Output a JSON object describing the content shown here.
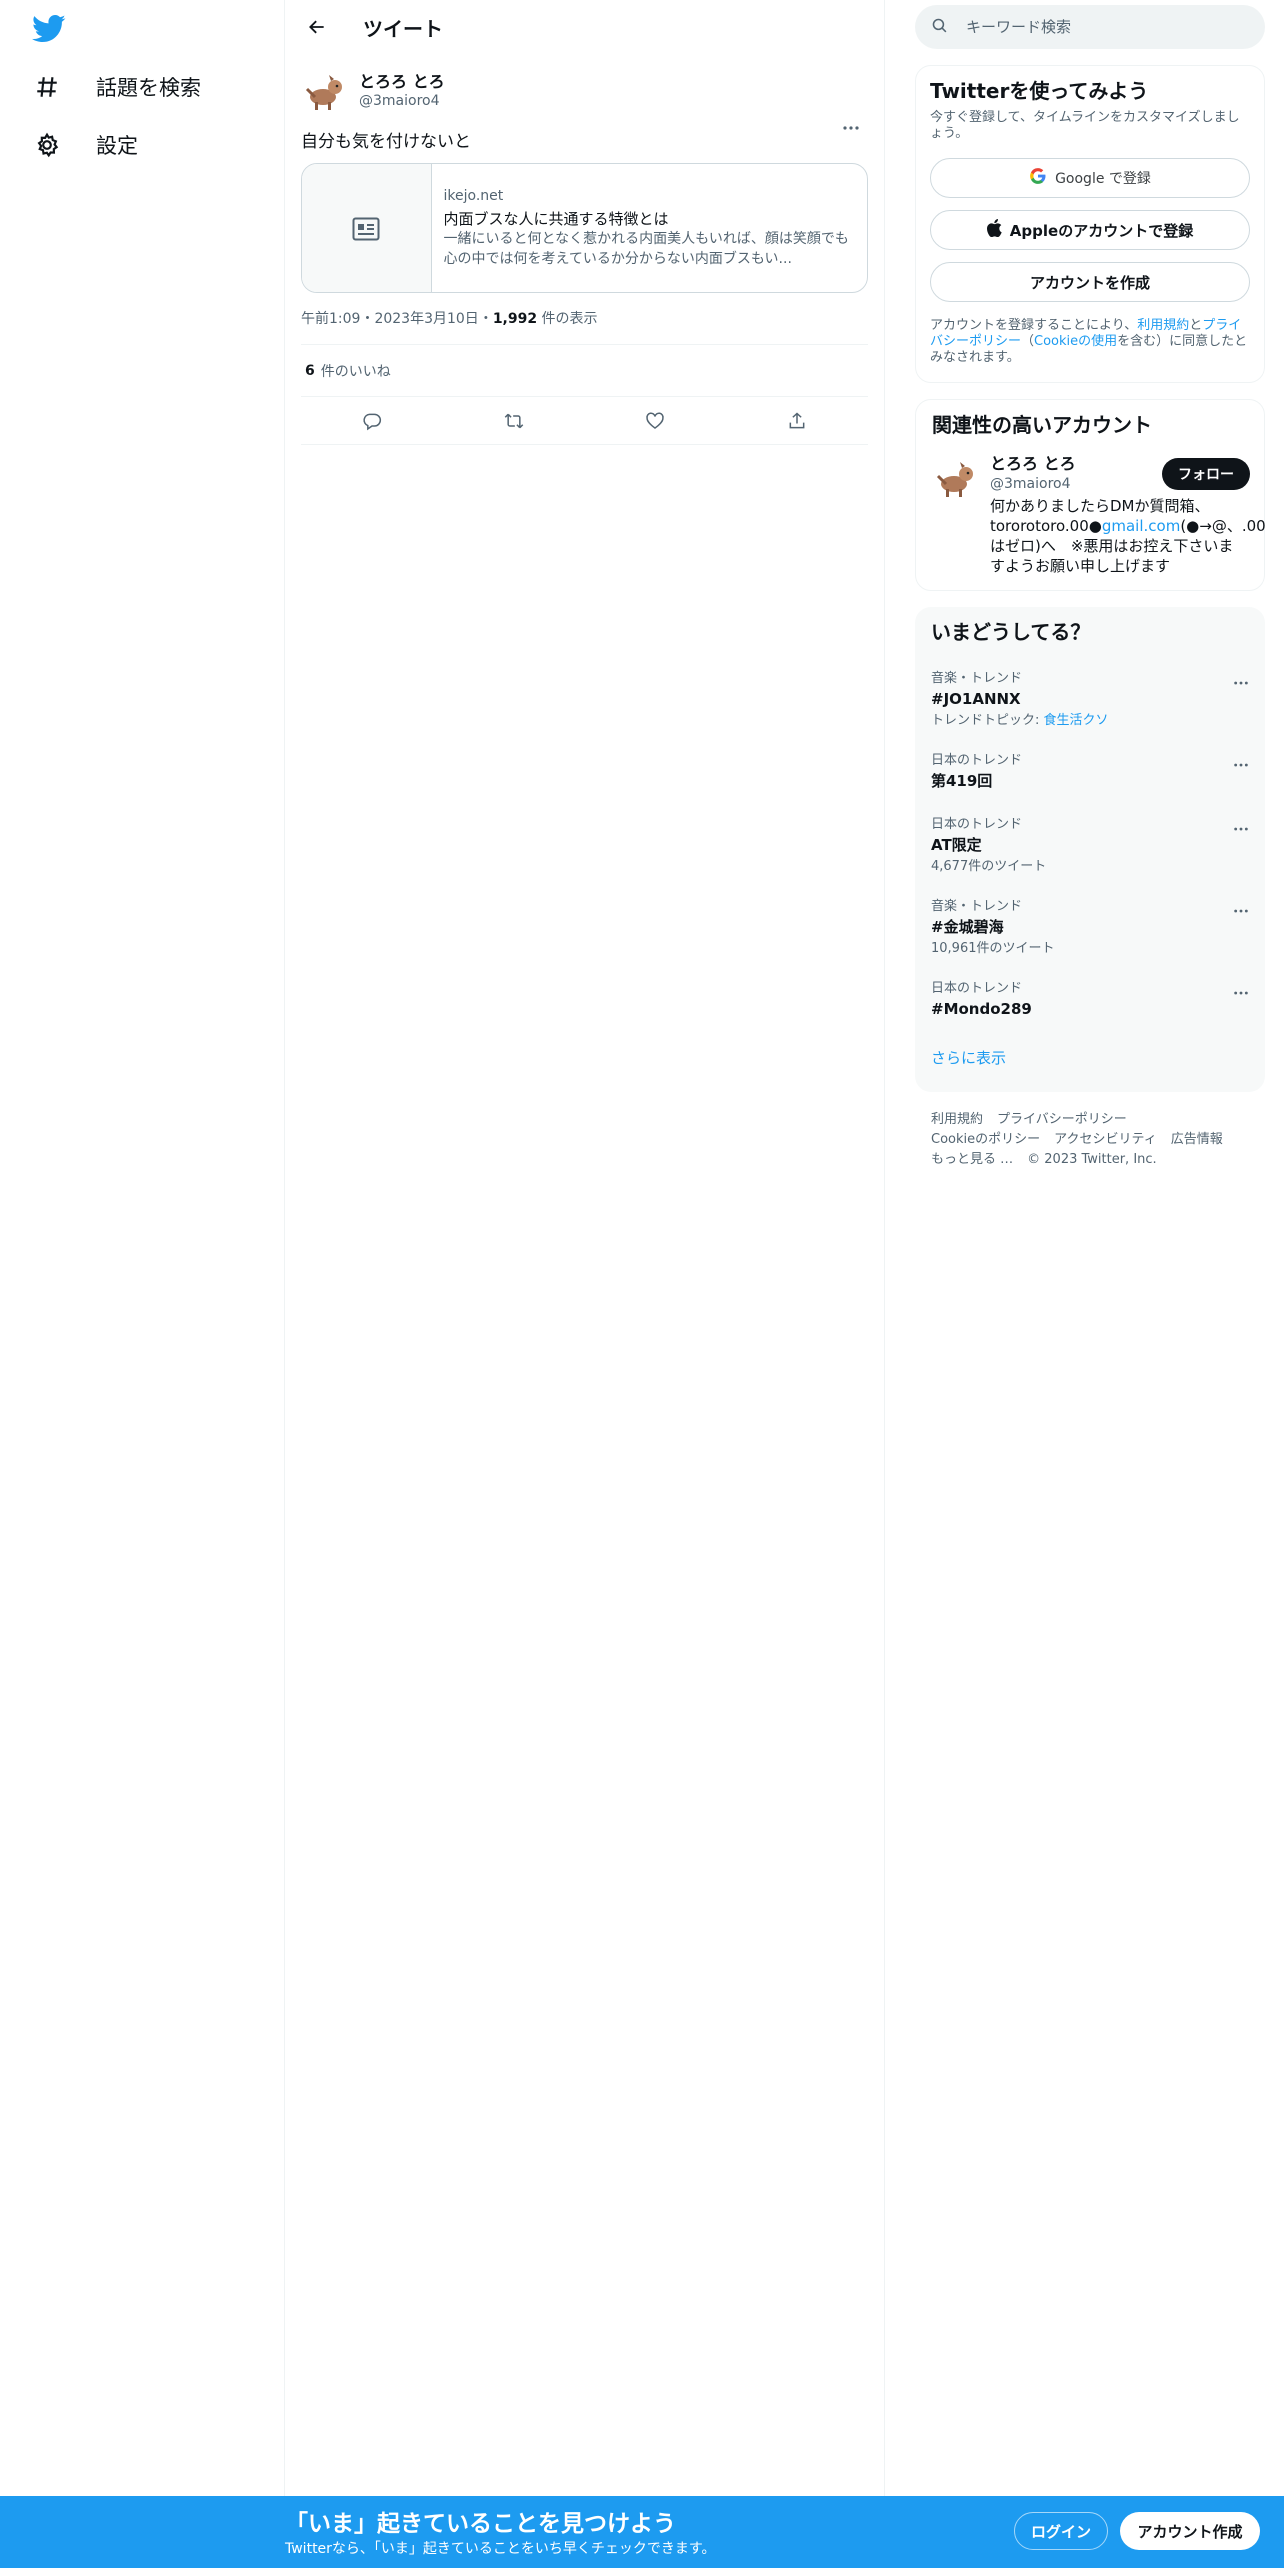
{
  "nav": {
    "items": [
      {
        "label": "話題を検索",
        "icon": "hashtag-icon"
      },
      {
        "label": "設定",
        "icon": "gear-icon"
      }
    ]
  },
  "header": {
    "title": "ツイート"
  },
  "tweet": {
    "author_name": "とろろ とろ",
    "author_handle": "@3maioro4",
    "text": "自分も気を付けないと",
    "card": {
      "domain": "ikejo.net",
      "title": "内面ブスな人に共通する特徴とは",
      "description": "一緒にいると何となく惹かれる内面美人もいれば、顔は笑顔でも心の中では何を考えているか分からない内面ブスもい..."
    },
    "time": "午前1:09",
    "sep1": "・",
    "date": "2023年3月10日",
    "sep2": "・",
    "views": "1,992",
    "views_label": " 件の表示",
    "likes_count": "6",
    "likes_label": "件のいいね"
  },
  "search": {
    "placeholder": "キーワード検索"
  },
  "signup": {
    "title": "Twitterを使ってみよう",
    "subtitle": "今すぐ登録して、タイムラインをカスタマイズしましょう。",
    "google_label": "Google で登録",
    "apple_label": "Appleのアカウントで登録",
    "create_label": "アカウントを作成",
    "terms_pre": "アカウントを登録することにより、",
    "terms_link1": "利用規約",
    "terms_mid1": "と",
    "terms_link2": "プライバシーポリシー",
    "terms_mid2": "（",
    "terms_link3": "Cookieの使用",
    "terms_post": "を含む）に同意したとみなされます。"
  },
  "related": {
    "title": "関連性の高いアカウント",
    "name": "とろろ とろ",
    "handle": "@3maioro4",
    "follow_label": "フォロー",
    "bio_pre": "何かありましたらDMか質問箱、tororotoro.00●",
    "bio_link": "gmail.com",
    "bio_post": "(●→@、.00はゼロ)へ　※悪用はお控え下さいますようお願い申し上げます"
  },
  "trends": {
    "title": "いまどうしてる？",
    "items": [
      {
        "context": "音楽・トレンド",
        "name": "#JO1ANNX",
        "sub_pre": "トレンドトピック: ",
        "sub_link": "食生活クソ"
      },
      {
        "context": "日本のトレンド",
        "name": "第419回",
        "sub": ""
      },
      {
        "context": "日本のトレンド",
        "name": "AT限定",
        "sub": "4,677件のツイート"
      },
      {
        "context": "音楽・トレンド",
        "name": "#金城碧海",
        "sub": "10,961件のツイート"
      },
      {
        "context": "日本のトレンド",
        "name": "#Mondo289",
        "sub": ""
      }
    ],
    "show_more": "さらに表示"
  },
  "footer": {
    "links": [
      "利用規約",
      "プライバシーポリシー",
      "Cookieのポリシー",
      "アクセシビリティ",
      "広告情報",
      "もっと見る …"
    ],
    "copyright": "© 2023 Twitter, Inc."
  },
  "bottom_bar": {
    "title": "「いま」起きていることを見つけよう",
    "subtitle": "Twitterなら、「いま」起きていることをいち早くチェックできます。",
    "login_label": "ログイン",
    "signup_label": "アカウント作成"
  },
  "colors": {
    "accent": "#1d9bf0",
    "text": "#0f1419",
    "muted": "#536471"
  }
}
